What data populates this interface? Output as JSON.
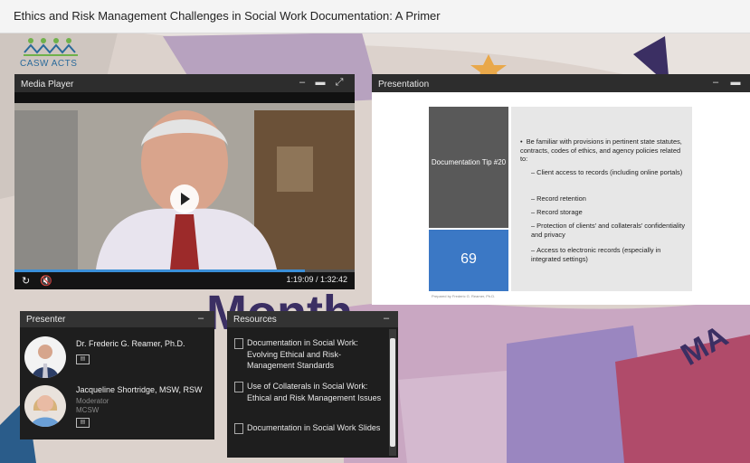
{
  "window": {
    "title": "Ethics and Risk Management Challenges in Social Work Documentation: A Primer"
  },
  "logo": {
    "text": "CASW ACTS"
  },
  "media_player": {
    "title": "Media Player",
    "time": "1:19:09 / 1:32:42",
    "progress": 0.853
  },
  "presentation": {
    "title": "Presentation",
    "slide": {
      "heading": "Documentation Tip #20",
      "number": "69",
      "bullet": "Be familiar with provisions in pertinent state statutes, contracts, codes of ethics, and agency policies related to:",
      "sub_items": [
        "Client access to records (including online portals)",
        "Record retention",
        "Record storage",
        "Protection of clients' and collaterals' confidentiality and privacy",
        "Access to electronic records (especially in integrated settings)"
      ],
      "footer": "Prepared by Frederic G. Reamer, Ph.D."
    }
  },
  "presenter": {
    "title": "Presenter",
    "people": [
      {
        "name": "Dr. Frederic G. Reamer, Ph.D.",
        "role": ""
      },
      {
        "name": "Jacqueline Shortridge, MSW, RSW",
        "role": "Moderator",
        "org": "MCSW"
      }
    ]
  },
  "resources": {
    "title": "Resources",
    "items": [
      "Documentation in Social Work: Evolving Ethical and Risk-Management Standards",
      "Use of Collaterals in Social Work: Ethical and Risk Management Issues",
      "Documentation in Social Work Slides"
    ]
  },
  "background": {
    "letters": "Month"
  },
  "colors": {
    "accent_blue": "#3b78c5",
    "progress": "#3a8fd8",
    "panel": "#1e1e1e"
  }
}
